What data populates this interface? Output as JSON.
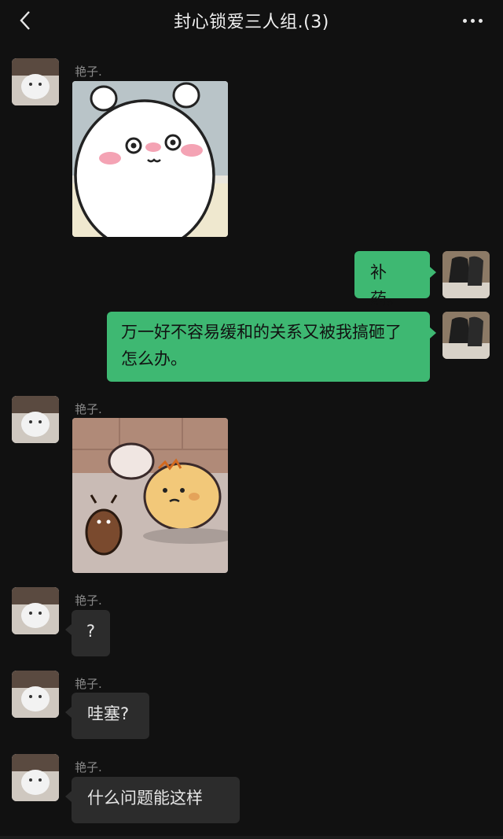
{
  "header": {
    "title": "封心锁爱三人组.(3)"
  },
  "messages": [
    {
      "sender": "艳子.",
      "type": "sticker",
      "sticker": "white-bear-blushing"
    },
    {
      "sender": "me",
      "type": "text",
      "text": "补药。"
    },
    {
      "sender": "me",
      "type": "text",
      "text": "万一好不容易缓和的关系又被我搞砸了怎么办。"
    },
    {
      "sender": "艳子.",
      "type": "sticker",
      "sticker": "hamster-and-beetle"
    },
    {
      "sender": "艳子.",
      "type": "text",
      "text": "?"
    },
    {
      "sender": "艳子.",
      "type": "text",
      "text": "哇塞?"
    },
    {
      "sender": "艳子.",
      "type": "text",
      "text": "什么问题能这样"
    }
  ],
  "colors": {
    "my_bubble": "#3eb872",
    "their_bubble": "#2c2c2c",
    "background": "#111111"
  }
}
